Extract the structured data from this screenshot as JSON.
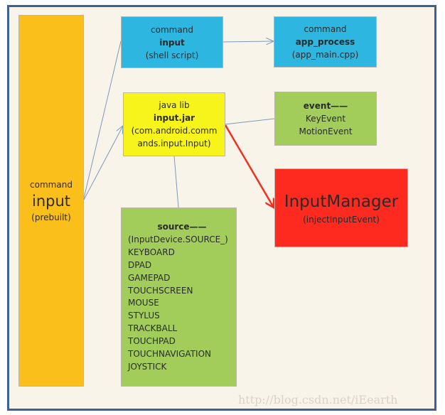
{
  "colors": {
    "frame": "#3d6095",
    "background": "#f9f4ea",
    "orange": "#fbbf1c",
    "blue": "#2db6e0",
    "yellow": "#f7f41c",
    "green": "#a2cd5a",
    "red": "#fe2a1f",
    "connector": "#7d98bd",
    "arrow_red": "#f2301f"
  },
  "prebuilt": {
    "line1": "command",
    "line2": "input",
    "line3": "(prebuilt)"
  },
  "shell": {
    "line1": "command",
    "line2": "input",
    "line3": "(shell script)"
  },
  "app_process": {
    "line1": "command",
    "line2": "app_process",
    "line3": "(app_main.cpp)"
  },
  "jar": {
    "line1": "java lib",
    "line2": "input.jar",
    "line3": "(com.android.comm",
    "line4": "ands.input.Input)"
  },
  "event": {
    "title": "event——",
    "items": [
      "KeyEvent",
      "MotionEvent"
    ]
  },
  "manager": {
    "title": "InputManager",
    "subtitle": "(injectInputEvent)"
  },
  "source": {
    "title": "source——",
    "prefix": "(InputDevice.SOURCE_)",
    "items": [
      "KEYBOARD",
      "DPAD",
      "GAMEPAD",
      "TOUCHSCREEN",
      "MOUSE",
      "STYLUS",
      "TRACKBALL",
      "TOUCHPAD",
      "TOUCHNAVIGATION",
      "JOYSTICK"
    ]
  },
  "watermark": "http://blog.csdn.net/iEearth"
}
